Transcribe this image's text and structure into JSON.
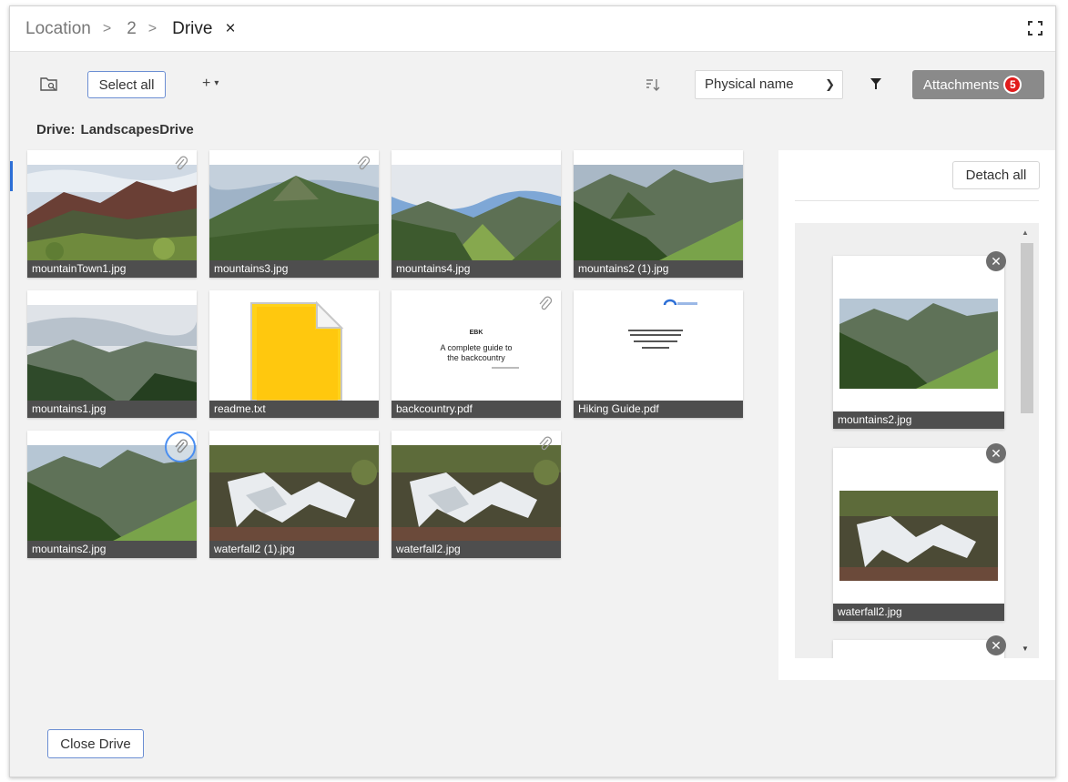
{
  "breadcrumb": {
    "items": [
      "Location",
      "2"
    ],
    "separator": ">",
    "current": "Drive",
    "close_glyph": "×"
  },
  "toolbar": {
    "folder_icon": "folder-search-icon",
    "select_all_label": "Select all",
    "add_label": "+",
    "add_caret": "▾",
    "sort_icon": "sort-icon",
    "sort_value": "Physical name",
    "filter_icon": "filter-icon",
    "attachments_label": "Attachments",
    "attachments_count": "5"
  },
  "drive": {
    "label": "Drive:",
    "name": "LandscapesDrive"
  },
  "tiles": [
    {
      "name": "mountainTown1.jpg",
      "kind": "image",
      "attached": true
    },
    {
      "name": "mountains3.jpg",
      "kind": "image",
      "attached": true
    },
    {
      "name": "mountains4.jpg",
      "kind": "image",
      "attached": false
    },
    {
      "name": "mountains2 (1).jpg",
      "kind": "image",
      "attached": false
    },
    {
      "name": "mountains1.jpg",
      "kind": "image",
      "attached": false
    },
    {
      "name": "readme.txt",
      "kind": "text",
      "attached": false
    },
    {
      "name": "backcountry.pdf",
      "kind": "pdf",
      "attached": true
    },
    {
      "name": "Hiking Guide.pdf",
      "kind": "pdf",
      "attached": false
    },
    {
      "name": "mountains2.jpg",
      "kind": "image",
      "attached": true
    },
    {
      "name": "waterfall2 (1).jpg",
      "kind": "image",
      "attached": false
    },
    {
      "name": "waterfall2.jpg",
      "kind": "image",
      "attached": true
    }
  ],
  "backcountry_doc": {
    "line1": "EBK",
    "line2": "A complete guide to",
    "line3": "the backcountry"
  },
  "panel": {
    "detach_all_label": "Detach all",
    "remove_glyph": "✕",
    "attachments": [
      {
        "name": "mountains2.jpg"
      },
      {
        "name": "waterfall2.jpg"
      }
    ]
  },
  "footer": {
    "close_drive_label": "Close Drive"
  },
  "colors": {
    "accent": "#2d6fd6",
    "badge": "#e11b1b",
    "caption_bg": "#4e4e4e",
    "attachments_btn": "#8a8a8a"
  }
}
